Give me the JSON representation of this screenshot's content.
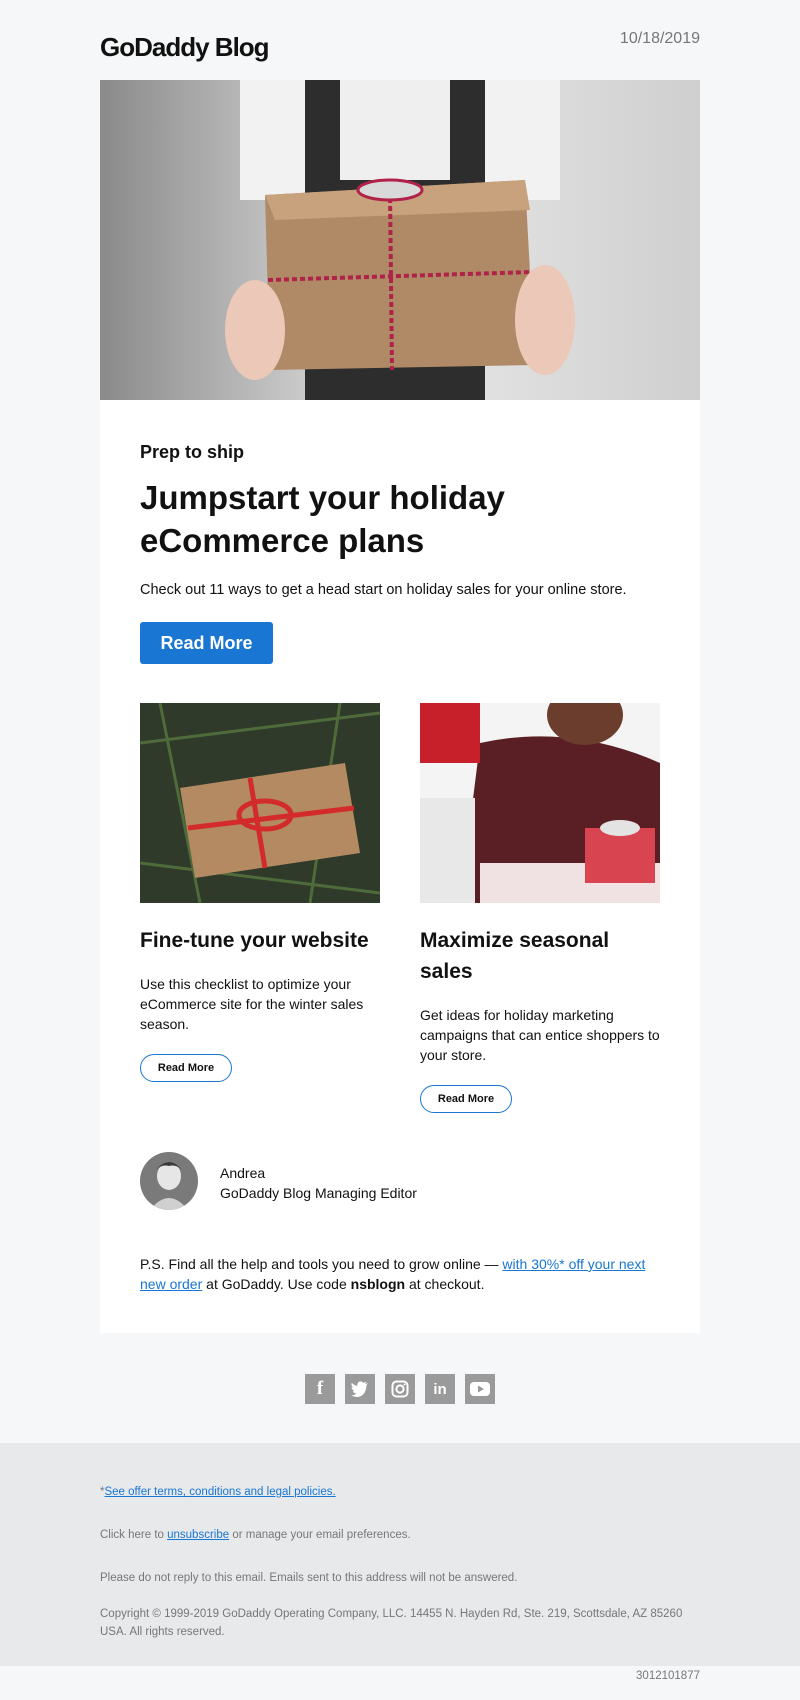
{
  "header": {
    "brand": "GoDaddy Blog",
    "date": "10/18/2019"
  },
  "hero": {
    "alt": "Hands holding a gift box wrapped in candy-cane paper"
  },
  "feature": {
    "eyebrow": "Prep to ship",
    "headline": "Jumpstart your holiday eCommerce plans",
    "lead": "Check out 11 ways to get a head start on holiday sales for your online store.",
    "cta": "Read More"
  },
  "articles": [
    {
      "title": "Fine-tune your website",
      "text": "Use this checklist to optimize your eCommerce site for the winter sales season.",
      "cta": "Read More"
    },
    {
      "title": "Maximize seasonal sales",
      "text": "Get ideas for holiday marketing campaigns that can entice shoppers to your store.",
      "cta": "Read More"
    }
  ],
  "author": {
    "name": "Andrea",
    "role": "GoDaddy Blog Managing Editor"
  },
  "ps": {
    "prefix": "P.S. Find all the help and tools you need to grow online — ",
    "link": "with 30%* off your next new order",
    "middle": " at GoDaddy. Use code ",
    "code": "nsblogn",
    "suffix": " at checkout."
  },
  "social": [
    "facebook-icon",
    "twitter-icon",
    "instagram-icon",
    "linkedin-icon",
    "youtube-icon"
  ],
  "footer": {
    "offer_prefix": "*",
    "offer_link": "See offer terms, conditions and legal policies.",
    "unsub_prefix": "Click here to ",
    "unsub_link": "unsubscribe",
    "unsub_suffix": " or manage your email preferences.",
    "noreply": "Please do not reply to this email. Emails sent to this address will not be answered.",
    "copyright": "Copyright © 1999-2019 GoDaddy Operating Company, LLC. 14455 N. Hayden Rd, Ste. 219, Scottsdale, AZ 85260 USA. All rights reserved.",
    "id": "3012101877"
  },
  "colors": {
    "accent": "#1976d2",
    "page_bg": "#f5f7f8",
    "footer_bg": "#e8e9eb",
    "icon_gray": "#9a9a9a"
  }
}
